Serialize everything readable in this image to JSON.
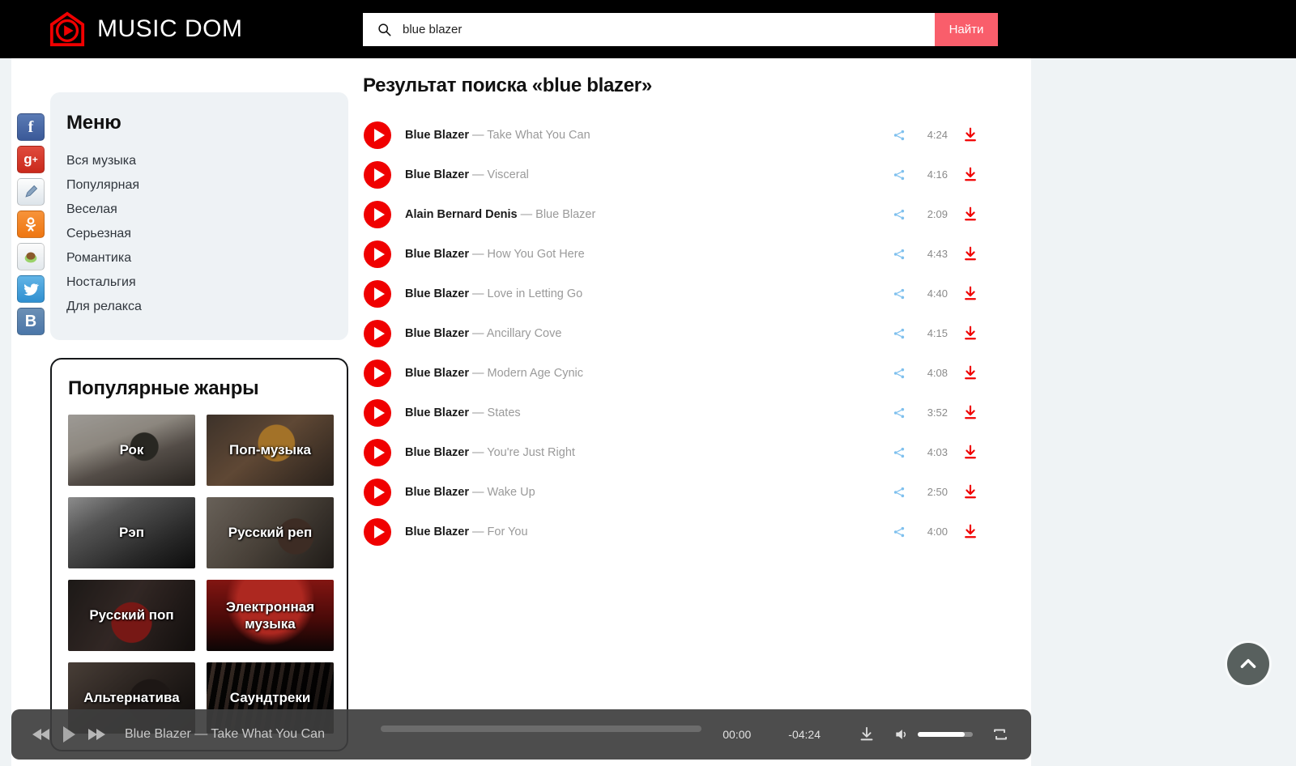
{
  "header": {
    "logo_text": "MUSIC DOM",
    "logo_icon": "house-play-logo-icon",
    "search": {
      "value": "blue blazer",
      "placeholder": "",
      "button_label": "Найти",
      "icon": "search-icon",
      "button_color": "#f95e6b"
    }
  },
  "social": [
    {
      "name": "facebook",
      "glyph": "f"
    },
    {
      "name": "google-plus",
      "glyph": "g+"
    },
    {
      "name": "livejournal",
      "glyph": "✎"
    },
    {
      "name": "odnoklassniki",
      "glyph": "ok"
    },
    {
      "name": "liveinternet",
      "glyph": "●"
    },
    {
      "name": "twitter",
      "glyph": "🐦"
    },
    {
      "name": "vkontakte",
      "glyph": "B"
    }
  ],
  "sidebar": {
    "menu_title": "Меню",
    "menu_items": [
      "Вся музыка",
      "Популярная",
      "Веселая",
      "Серьезная",
      "Романтика",
      "Ностальгия",
      "Для релакса"
    ],
    "genres_title": "Популярные жанры",
    "genres": [
      {
        "label": "Рок",
        "bg": "bg-rock"
      },
      {
        "label": "Поп-музыка",
        "bg": "bg-pop"
      },
      {
        "label": "Рэп",
        "bg": "bg-rap"
      },
      {
        "label": "Русский реп",
        "bg": "bg-rusrap"
      },
      {
        "label": "Русский поп",
        "bg": "bg-ruspop"
      },
      {
        "label": "Электронная музыка",
        "bg": "bg-edm"
      },
      {
        "label": "Альтернатива",
        "bg": "bg-alt"
      },
      {
        "label": "Саундтреки",
        "bg": "bg-ost"
      }
    ]
  },
  "main": {
    "results_title": "Результат поиска «blue blazer»",
    "tracks": [
      {
        "artist": "Blue Blazer",
        "title": "Take What You Can",
        "duration": "4:24"
      },
      {
        "artist": "Blue Blazer",
        "title": "Visceral",
        "duration": "4:16"
      },
      {
        "artist": "Alain Bernard Denis",
        "title": "Blue Blazer",
        "duration": "2:09"
      },
      {
        "artist": "Blue Blazer",
        "title": "How You Got Here",
        "duration": "4:43"
      },
      {
        "artist": "Blue Blazer",
        "title": "Love in Letting Go",
        "duration": "4:40"
      },
      {
        "artist": "Blue Blazer",
        "title": "Ancillary Cove",
        "duration": "4:15"
      },
      {
        "artist": "Blue Blazer",
        "title": "Modern Age Cynic",
        "duration": "4:08"
      },
      {
        "artist": "Blue Blazer",
        "title": "States",
        "duration": "3:52"
      },
      {
        "artist": "Blue Blazer",
        "title": "You're Just Right",
        "duration": "4:03"
      },
      {
        "artist": "Blue Blazer",
        "title": "Wake Up",
        "duration": "2:50"
      },
      {
        "artist": "Blue Blazer",
        "title": "For You",
        "duration": "4:00"
      }
    ],
    "separator": "—"
  },
  "player": {
    "now_playing": "Blue Blazer — Take What You Can",
    "time_elapsed": "00:00",
    "time_remaining": "-04:24",
    "progress_percent": 0,
    "volume_percent": 85,
    "icons": {
      "prev": "previous-icon",
      "play": "play-icon",
      "next": "next-icon",
      "download": "download-icon",
      "volume": "volume-icon",
      "repeat": "repeat-icon"
    }
  },
  "scroll_top": {
    "name": "scroll-to-top-button",
    "icon": "chevron-up-icon"
  },
  "colors": {
    "accent_red": "#f00000",
    "search_button": "#f95e6b",
    "page_bg": "#eff3f5",
    "header_bg": "#000000",
    "share_blue": "#7ec0ee"
  }
}
